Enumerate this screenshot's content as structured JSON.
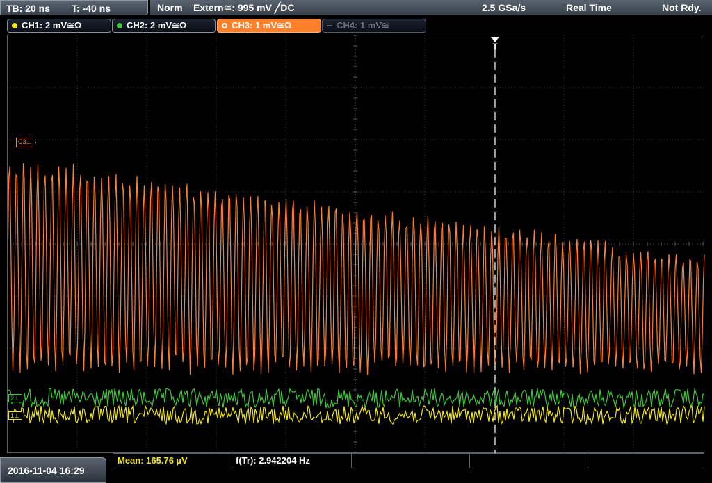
{
  "topbar": {
    "timebase": "TB: 20 ns",
    "trigger_pos": "T: -40 ns",
    "acq_mode": "Norm",
    "trigger_source": "Extern≅: 995 mV ╱DC",
    "sample_rate": "2.5 GSa/s",
    "realtime": "Real Time",
    "status": "Not Rdy."
  },
  "channels": [
    {
      "label": "CH1: 2 mV≅Ω",
      "color": "#f4e81c",
      "state": "on"
    },
    {
      "label": "CH2: 2 mV≅Ω",
      "color": "#3ec83a",
      "state": "on"
    },
    {
      "label": "CH3: 1 mV≅Ω",
      "color": "#ff7f2a",
      "state": "active"
    },
    {
      "label": "CH4: 1 mV≅",
      "color": "#6a707a",
      "state": "off"
    }
  ],
  "screen": {
    "c3_marker": "C3⊥",
    "ch1_marker": "1⊥",
    "ch2_marker": "2⊥",
    "trigger_marker": "T"
  },
  "bottombar": {
    "datetime": "2016-11-04 16:29",
    "mean_label": "Mean: 165.76 µV",
    "freq_label": "f(Tr): 2.942204 Hz"
  },
  "colors": {
    "ch1": "#f4e81c",
    "ch2": "#3ec83a",
    "ch3": "#ff7f2a",
    "grid": "#3a3f45"
  }
}
